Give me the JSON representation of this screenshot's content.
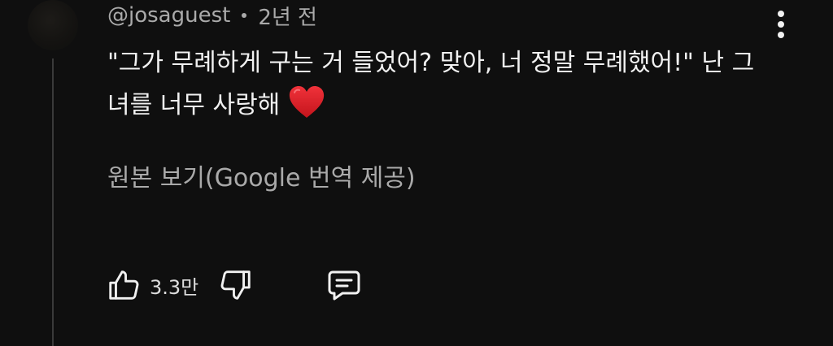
{
  "comment": {
    "author": "@josaguest",
    "separator": "•",
    "time": "2년 전",
    "text": "\"그가 무례하게 구는 거 들었어? 맞아, 너 정말 무례했어!\" 난 그녀를 너무 사랑해",
    "emoji_icon": "red-heart-emoji",
    "translate_link": "원본 보기(Google 번역 제공)",
    "likes": "3.3만"
  },
  "icons": {
    "more": "more-vertical-icon",
    "like": "thumbs-up-icon",
    "dislike": "thumbs-down-icon",
    "reply": "comment-reply-icon"
  },
  "colors": {
    "background": "#0f0f0f",
    "primary_text": "#f1f1f1",
    "secondary_text": "#aaaaaa",
    "thread_line": "#3a3a3a",
    "heart": "#e0242a"
  }
}
